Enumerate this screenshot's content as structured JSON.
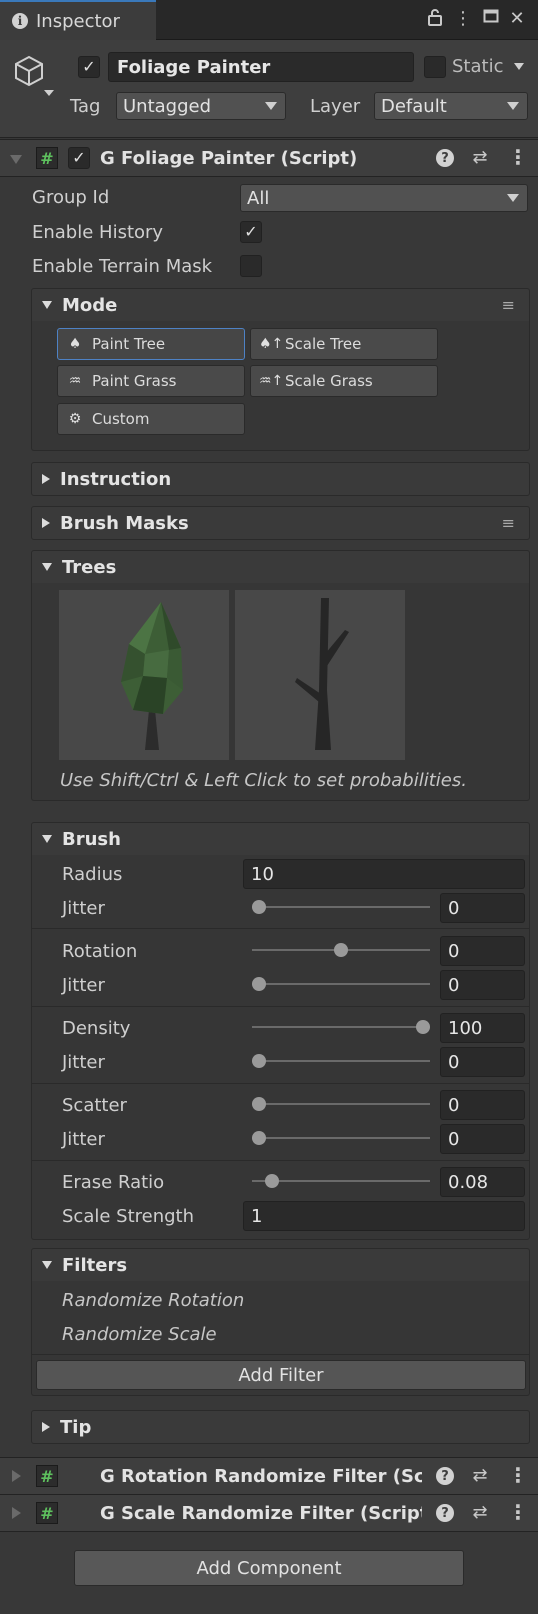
{
  "window": {
    "tab_label": "Inspector",
    "lock_icon": "lock-icon",
    "menu_icon": "kebab-menu-icon",
    "maximize_icon": "maximize-icon",
    "close_icon": "close-icon"
  },
  "gameobject": {
    "icon": "cube-icon",
    "active": true,
    "name": "Foliage Painter",
    "static_checked": false,
    "static_label": "Static",
    "tag_label": "Tag",
    "tag_value": "Untagged",
    "layer_label": "Layer",
    "layer_value": "Default"
  },
  "component": {
    "enabled": true,
    "title": "G Foliage Painter (Script)",
    "fields": {
      "group_id_label": "Group Id",
      "group_id_value": "All",
      "enable_history_label": "Enable History",
      "enable_history_checked": true,
      "enable_terrain_mask_label": "Enable Terrain Mask",
      "enable_terrain_mask_checked": false
    },
    "mode": {
      "title": "Mode",
      "buttons": [
        {
          "label": "Paint Tree",
          "icon": "tree-icon",
          "active": true
        },
        {
          "label": "Scale Tree",
          "icon": "scale-tree-icon",
          "active": false
        },
        {
          "label": "Paint Grass",
          "icon": "grass-icon",
          "active": false
        },
        {
          "label": "Scale Grass",
          "icon": "scale-grass-icon",
          "active": false
        },
        {
          "label": "Custom",
          "icon": "gear-icon",
          "active": false
        }
      ]
    },
    "instruction_title": "Instruction",
    "brush_masks_title": "Brush Masks",
    "trees": {
      "title": "Trees",
      "hint": "Use Shift/Ctrl & Left Click to set probabilities.",
      "items": [
        "leafy-tree-thumbnail",
        "bare-tree-thumbnail"
      ]
    },
    "brush": {
      "title": "Brush",
      "radius_label": "Radius",
      "radius_value": "10",
      "radius_jitter_label": "Jitter",
      "radius_jitter_value": "0",
      "radius_jitter_fraction": 0,
      "rotation_label": "Rotation",
      "rotation_value": "0",
      "rotation_fraction": 0.5,
      "rotation_jitter_label": "Jitter",
      "rotation_jitter_value": "0",
      "rotation_jitter_fraction": 0,
      "density_label": "Density",
      "density_value": "100",
      "density_fraction": 1,
      "density_jitter_label": "Jitter",
      "density_jitter_value": "0",
      "density_jitter_fraction": 0,
      "scatter_label": "Scatter",
      "scatter_value": "0",
      "scatter_fraction": 0,
      "scatter_jitter_label": "Jitter",
      "scatter_jitter_value": "0",
      "scatter_jitter_fraction": 0,
      "erase_ratio_label": "Erase Ratio",
      "erase_ratio_value": "0.08",
      "erase_ratio_fraction": 0.08,
      "scale_strength_label": "Scale Strength",
      "scale_strength_value": "1"
    },
    "filters": {
      "title": "Filters",
      "items": [
        "Randomize Rotation",
        "Randomize Scale"
      ],
      "add_label": "Add Filter"
    },
    "tip_title": "Tip"
  },
  "other_components": [
    {
      "title": "G Rotation Randomize Filter (Scr",
      "enabled": true
    },
    {
      "title": "G Scale Randomize Filter (Script",
      "enabled": true
    }
  ],
  "add_component_label": "Add Component"
}
